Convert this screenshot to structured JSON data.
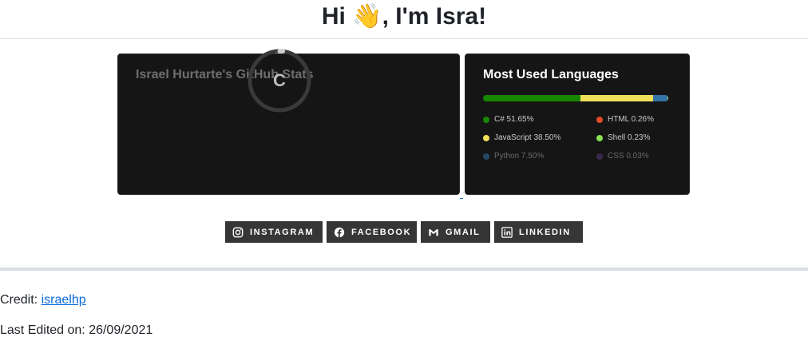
{
  "header": {
    "title": "Hi 👋, I'm Isra!"
  },
  "stats_card": {
    "title": "Israel Hurtarte's GitHub Stats",
    "rank": "C",
    "rank_progress": 0.02
  },
  "languages_card": {
    "title": "Most Used Languages",
    "languages": [
      {
        "label": "C# 51.65%",
        "percent": 51.65,
        "color": "#178600"
      },
      {
        "label": "JavaScript 38.50%",
        "percent": 38.5,
        "color": "#f1e05a"
      },
      {
        "label": "Python 7.50%",
        "percent": 7.5,
        "color": "#3572A5"
      },
      {
        "label": "HTML 0.26%",
        "percent": 0.26,
        "color": "#e34c26"
      },
      {
        "label": "Shell 0.23%",
        "percent": 0.23,
        "color": "#89e051"
      },
      {
        "label": "CSS 0.03%",
        "percent": 0.03,
        "color": "#563d7c"
      }
    ]
  },
  "socials": [
    {
      "label": "INSTAGRAM",
      "icon": "instagram-icon"
    },
    {
      "label": "FACEBOOK",
      "icon": "facebook-icon"
    },
    {
      "label": "GMAIL",
      "icon": "gmail-icon"
    },
    {
      "label": "LINKEDIN",
      "icon": "linkedin-icon"
    }
  ],
  "footer": {
    "credit_prefix": "Credit: ",
    "credit_link": "israelhp",
    "last_edited": "Last Edited on: 26/09/2021"
  }
}
